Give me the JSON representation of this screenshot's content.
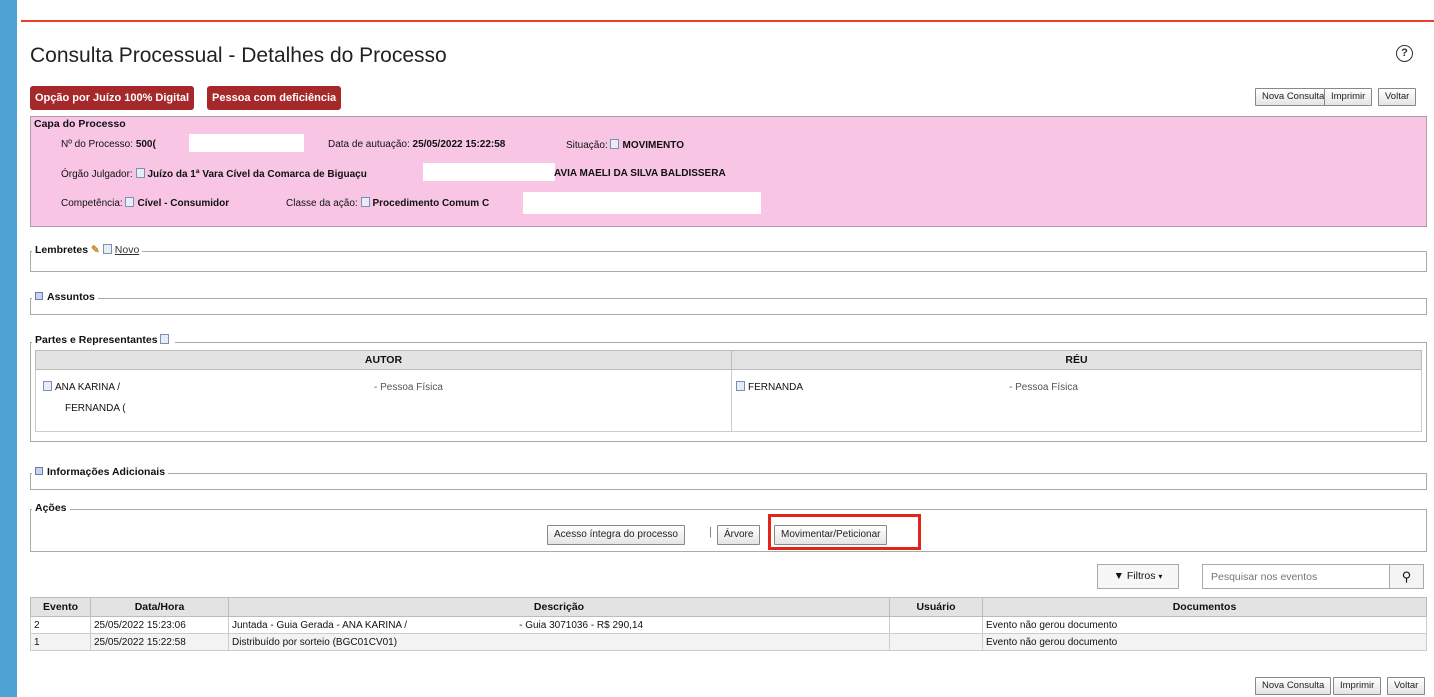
{
  "page_title": "Consulta Processual - Detalhes do Processo",
  "help_icon": "?",
  "badges": {
    "juizo_digital": "Opção por Juízo 100% Digital",
    "deficiencia": "Pessoa com deficiência"
  },
  "toolbar": {
    "nova_consulta": "Nova Consulta",
    "imprimir": "Imprimir",
    "voltar": "Voltar"
  },
  "capa": {
    "legend": "Capa do Processo",
    "numero_label": "Nº do Processo:",
    "numero_value": "500(",
    "data_label": "Data de autuação:",
    "data_value": "25/05/2022 15:22:58",
    "situacao_label": "Situação:",
    "situacao_value": "MOVIMENTO",
    "orgao_label": "Órgão Julgador:",
    "orgao_value": "Juízo da 1ª Vara Cível da Comarca de Biguaçu",
    "orgao_value2": "AVIA MAELI DA SILVA BALDISSERA",
    "competencia_label": "Competência:",
    "competencia_value": "Cível - Consumidor",
    "classe_label": "Classe da ação:",
    "classe_value": "Procedimento Comum C"
  },
  "lembretes": {
    "legend": "Lembretes",
    "novo_link": "Novo"
  },
  "assuntos": {
    "legend": "Assuntos"
  },
  "partes": {
    "legend": "Partes e Representantes",
    "autor_header": "AUTOR",
    "reu_header": "RÉU",
    "autor_name": "ANA KARINA /",
    "autor_tipo": "- Pessoa Física",
    "autor_rep": "FERNANDA (",
    "reu_name": "FERNANDA",
    "reu_tipo": "- Pessoa Física"
  },
  "info_adicionais": {
    "legend": "Informações Adicionais"
  },
  "acoes": {
    "legend": "Ações",
    "acesso": "Acesso íntegra do processo",
    "arvore": "Árvore",
    "movimentar": "Movimentar/Peticionar"
  },
  "eventos": {
    "filtros": "Filtros",
    "search_placeholder": "Pesquisar nos eventos",
    "headers": [
      "Evento",
      "Data/Hora",
      "Descrição",
      "Usuário",
      "Documentos"
    ],
    "rows": [
      {
        "evento": "2",
        "data": "25/05/2022 15:23:06",
        "descricao": "Juntada - Guia Gerada - ANA KARINA /",
        "descricao2": "- Guia 3071036 - R$ 290,14",
        "usuario": "",
        "documentos": "Evento não gerou documento"
      },
      {
        "evento": "1",
        "data": "25/05/2022 15:22:58",
        "descricao": "Distribuído por sorteio (BGC01CV01)",
        "descricao2": "",
        "usuario": "",
        "documentos": "Evento não gerou documento"
      }
    ]
  },
  "colors": {
    "background_frame": "#4fa3d4",
    "badge_red": "#a5282a",
    "capa_pink": "#f8c6e4",
    "top_line": "#e8402c",
    "highlight_box": "#e0251b"
  }
}
